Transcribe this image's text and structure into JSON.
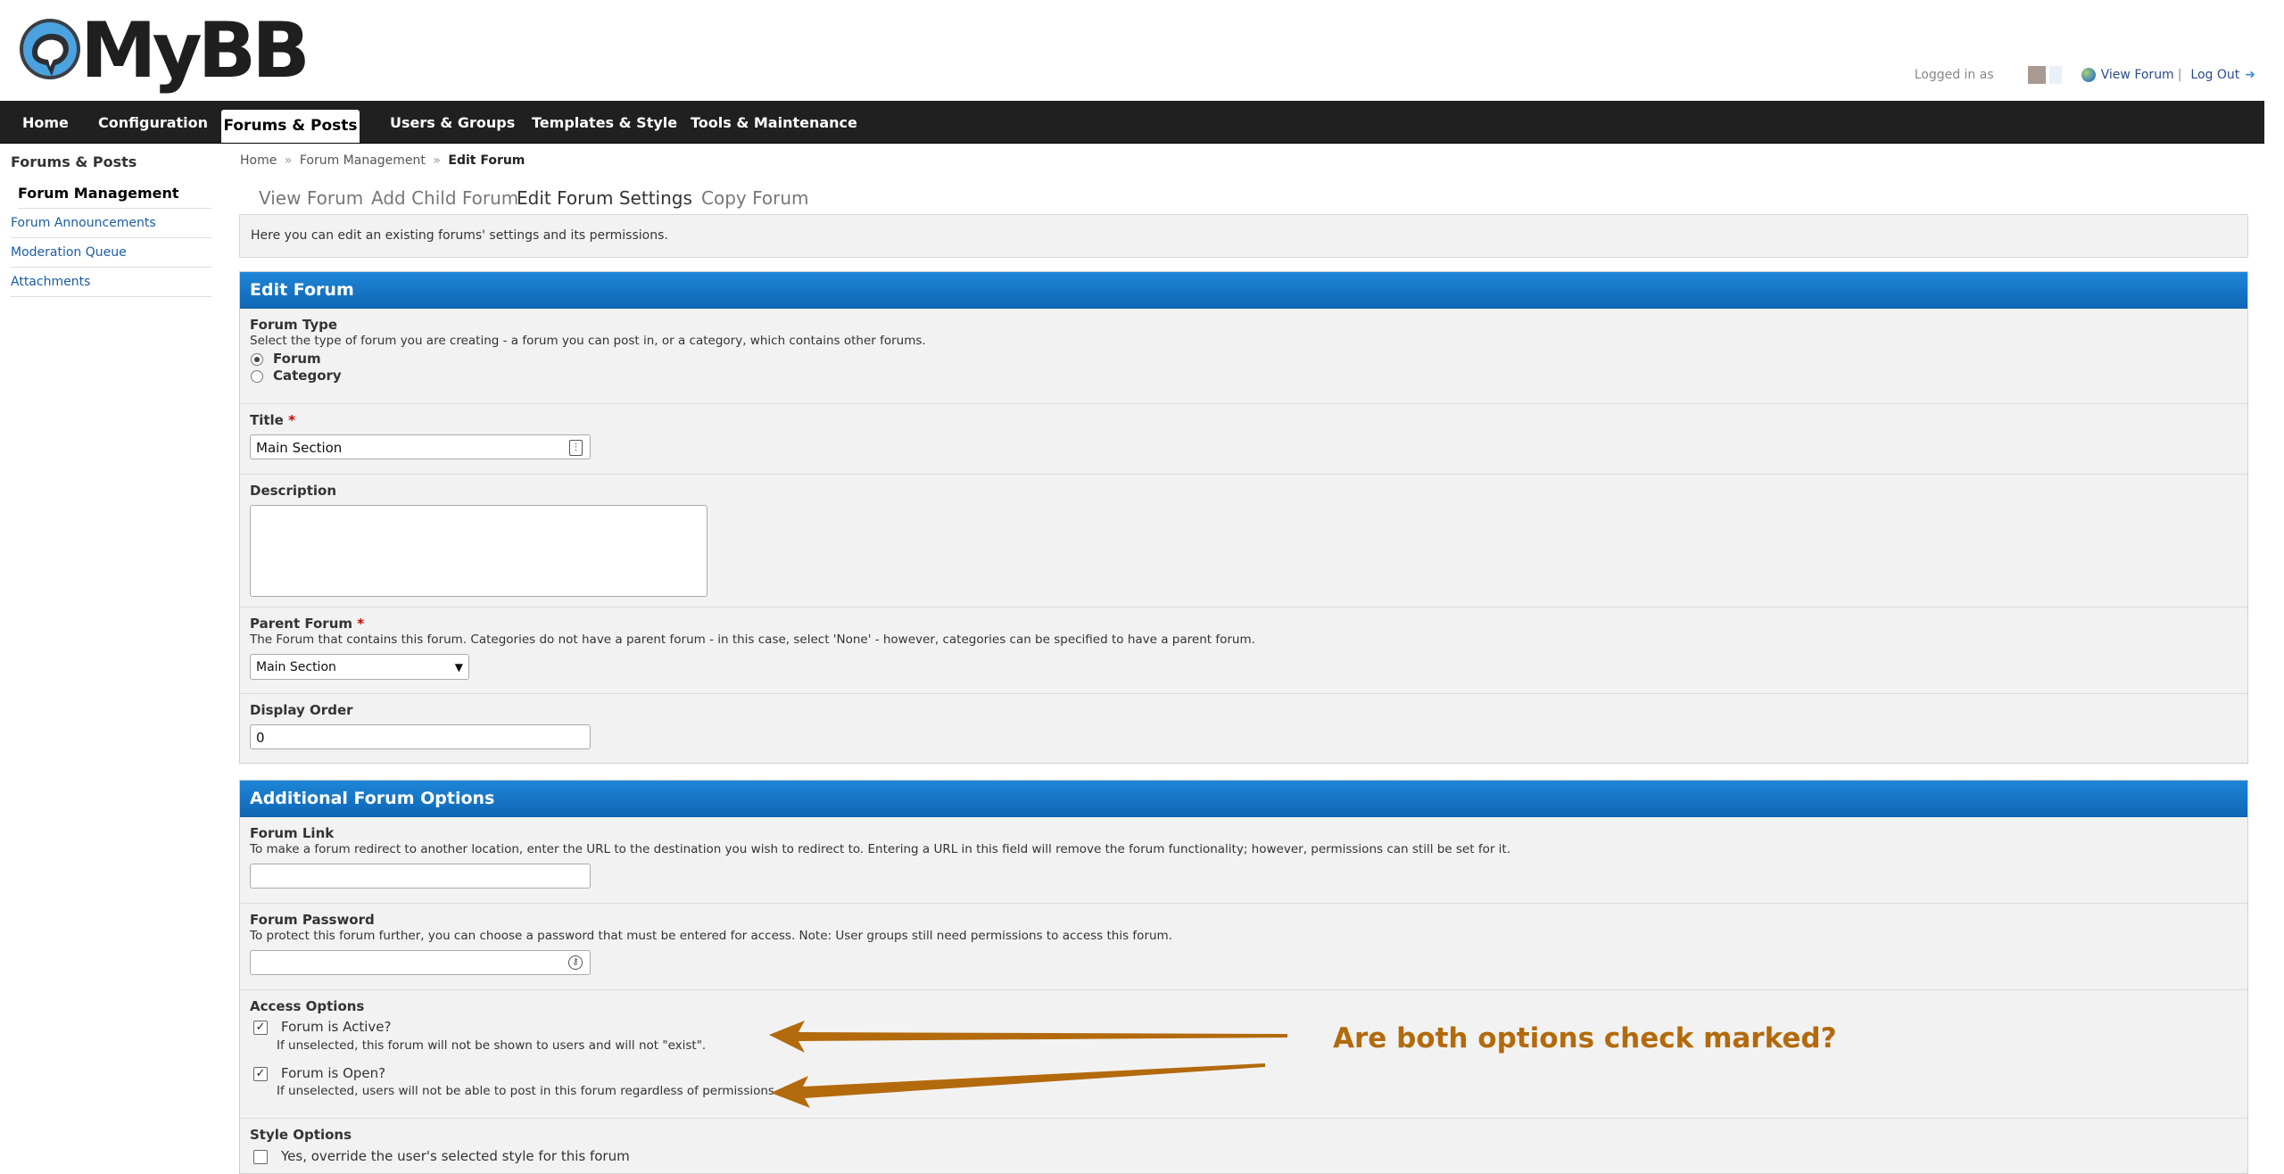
{
  "header": {
    "logo_text": "MyBB",
    "logged_in_text": "Logged in as",
    "view_forum": "View Forum",
    "separator": "|",
    "log_out": "Log Out"
  },
  "topnav": [
    "Home",
    "Configuration",
    "Forums & Posts",
    "Users & Groups",
    "Templates & Style",
    "Tools & Maintenance"
  ],
  "sidebar": {
    "title": "Forums & Posts",
    "items": [
      "Forum Management",
      "Forum Announcements",
      "Moderation Queue",
      "Attachments"
    ]
  },
  "breadcrumb": {
    "home": "Home",
    "arrow": "»",
    "mid": "Forum Management",
    "current": "Edit Forum"
  },
  "subtabs": [
    "View Forum",
    "Add Child Forum",
    "Edit Forum Settings",
    "Copy Forum"
  ],
  "intro": "Here you can edit an existing forums' settings and its permissions.",
  "edit_forum": {
    "heading": "Edit Forum",
    "forum_type": {
      "label": "Forum Type",
      "desc": "Select the type of forum you are creating - a forum you can post in, or a category, which contains other forums.",
      "options": [
        "Forum",
        "Category"
      ],
      "selected": "Forum"
    },
    "title": {
      "label": "Title",
      "required": "*",
      "value": "Main Section"
    },
    "description": {
      "label": "Description",
      "value": ""
    },
    "parent": {
      "label": "Parent Forum",
      "required": "*",
      "desc": "The Forum that contains this forum. Categories do not have a parent forum - in this case, select 'None' - however, categories can be specified to have a parent forum.",
      "selected": "Main Section"
    },
    "display_order": {
      "label": "Display Order",
      "value": "0"
    }
  },
  "additional": {
    "heading": "Additional Forum Options",
    "forum_link": {
      "label": "Forum Link",
      "desc": "To make a forum redirect to another location, enter the URL to the destination you wish to redirect to. Entering a URL in this field will remove the forum functionality; however, permissions can still be set for it.",
      "value": ""
    },
    "forum_password": {
      "label": "Forum Password",
      "desc": "To protect this forum further, you can choose a password that must be entered for access. Note: User groups still need permissions to access this forum.",
      "value": ""
    },
    "access": {
      "label": "Access Options",
      "active_label": "Forum is Active?",
      "active_desc": "If unselected, this forum will not be shown to users and will not \"exist\".",
      "active_checked": true,
      "open_label": "Forum is Open?",
      "open_desc": "If unselected, users will not be able to post in this forum regardless of permissions.",
      "open_checked": true
    },
    "style": {
      "label": "Style Options",
      "override_label": "Yes, override the user's selected style for this forum"
    }
  },
  "annotation": {
    "text": "Are both options check marked?",
    "color": "#b36a0c"
  },
  "colors": {
    "panel_header": "#1678cc",
    "nav_bg": "#202020",
    "link": "#1a5ca8"
  }
}
